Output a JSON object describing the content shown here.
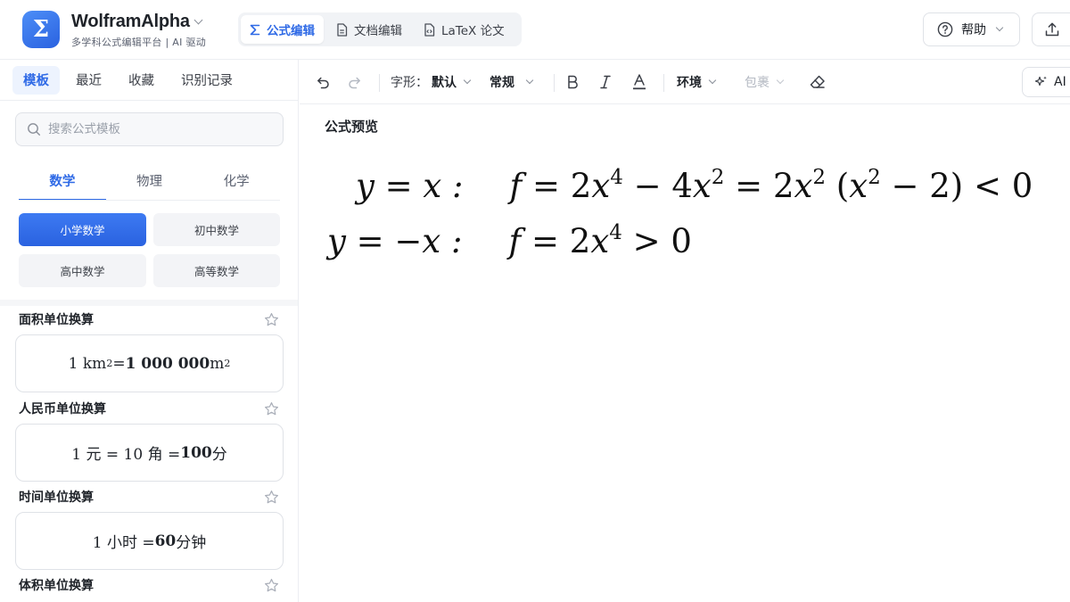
{
  "header": {
    "brand_name": "WolframAlpha",
    "brand_sub": "多学科公式编辑平台 | AI 驱动",
    "logo_glyph": "Σ",
    "mode_tabs": [
      {
        "label": "公式编辑",
        "active": true,
        "icon": "sigma-icon"
      },
      {
        "label": "文档编辑",
        "active": false,
        "icon": "document-icon"
      },
      {
        "label": "LaTeX 论文",
        "active": false,
        "icon": "latex-file-icon"
      }
    ],
    "help_label": "帮助",
    "accent_color": "#2f6ae6"
  },
  "sidebar": {
    "tabs": [
      {
        "label": "模板",
        "active": true
      },
      {
        "label": "最近",
        "active": false
      },
      {
        "label": "收藏",
        "active": false
      },
      {
        "label": "识别记录",
        "active": false
      }
    ],
    "search_placeholder": "搜索公式模板",
    "subjects": [
      {
        "label": "数学",
        "active": true
      },
      {
        "label": "物理",
        "active": false
      },
      {
        "label": "化学",
        "active": false
      }
    ],
    "levels": [
      {
        "label": "小学数学",
        "active": true
      },
      {
        "label": "初中数学",
        "active": false
      },
      {
        "label": "高中数学",
        "active": false
      },
      {
        "label": "高等数学",
        "active": false
      }
    ],
    "categories": [
      {
        "title": "面积单位换算",
        "lhs": "1 km",
        "lhs_sup": "2",
        "mid": " = ",
        "rhs": "1 000 000",
        "rhs_unit": " m",
        "rhs_sup": "2"
      },
      {
        "title": "人民币单位换算",
        "p1": "1 元 = 10 角 = ",
        "p2": "100",
        "p3": " 分"
      },
      {
        "title": "时间单位换算",
        "p1": "1 小时 = ",
        "p2": "60",
        "p3": " 分钟"
      },
      {
        "title": "体积单位换算"
      }
    ]
  },
  "toolbar": {
    "font_label": "字形：",
    "font_value": "默认",
    "style_value": "常规",
    "env_label": "环境",
    "wrap_label": "包裹",
    "ai_label": "AI"
  },
  "preview": {
    "title": "公式预览",
    "line1": {
      "lhs": "y = x :",
      "f": "f",
      "eq": " = 2",
      "x": "x",
      "e1": "4",
      "m": " − 4",
      "x2": "x",
      "e2": "2",
      "eq2": " = 2",
      "x3": "x",
      "e3": "2",
      "paren_open": " (",
      "x4": "x",
      "e4": "2",
      "rest": " − 2) < 0"
    },
    "line2": {
      "lhs": "y = −x :",
      "f": "f",
      "eq": " = 2",
      "x": "x",
      "e1": "4",
      "rest": " > 0"
    }
  }
}
